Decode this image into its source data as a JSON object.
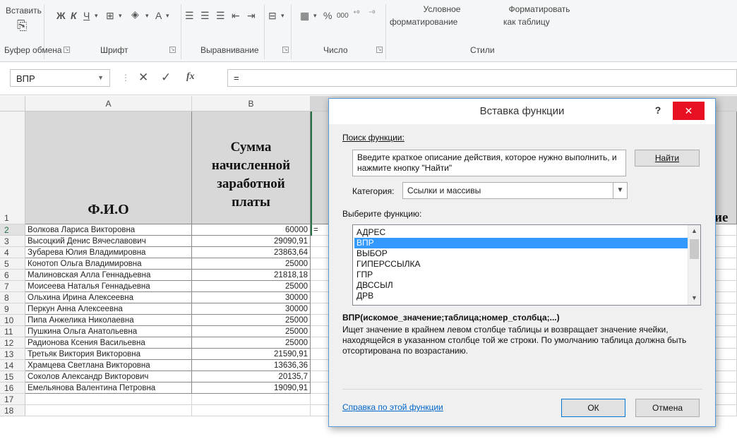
{
  "ribbon": {
    "paste_label": "Вставить",
    "font_buttons": [
      "Ж",
      "К",
      "Ч"
    ],
    "percent_label": "%",
    "thousands_label": "000",
    "cond_format_line1": "Условное",
    "cond_format_line2": "форматирование",
    "format_table_line1": "Форматировать",
    "format_table_line2": "как таблицу",
    "groups": {
      "clipboard": "Буфер обмена",
      "font": "Шрифт",
      "alignment": "Выравнивание",
      "number": "Число",
      "styles": "Стили"
    }
  },
  "formula_bar": {
    "name_box": "ВПР",
    "fx_label": "fx",
    "formula": "="
  },
  "sheet": {
    "columns": [
      "A",
      "B"
    ],
    "header_fio": "Ф.И.О",
    "header_sum_lines": [
      "Сумма",
      "начисленной",
      "заработной",
      "платы"
    ],
    "header_d_tail": "ие",
    "editing_cell": "=",
    "rows": [
      {
        "n": "2",
        "name": "Волкова Лариса Викторовна",
        "value": "60000"
      },
      {
        "n": "3",
        "name": "Высоцкий Денис Вячеславович",
        "value": "29090,91"
      },
      {
        "n": "4",
        "name": "Зубарева Юлия Владимировна",
        "value": "23863,64"
      },
      {
        "n": "5",
        "name": "Конотоп Ольга Владимировна",
        "value": "25000"
      },
      {
        "n": "6",
        "name": "Малиновская Алла Геннадьевна",
        "value": "21818,18"
      },
      {
        "n": "7",
        "name": "Моисеева Наталья Геннадьевна",
        "value": "25000"
      },
      {
        "n": "8",
        "name": "Ольхина Ирина Алексеевна",
        "value": "30000"
      },
      {
        "n": "9",
        "name": "Перкун Анна Алексеевна",
        "value": "30000"
      },
      {
        "n": "10",
        "name": "Пипа Анжелика Николаевна",
        "value": "25000"
      },
      {
        "n": "11",
        "name": "Пушкина Ольга Анатольевна",
        "value": "25000"
      },
      {
        "n": "12",
        "name": "Радионова Ксения Васильевна",
        "value": "25000"
      },
      {
        "n": "13",
        "name": "Третьяк Виктория Викторовна",
        "value": "21590,91"
      },
      {
        "n": "14",
        "name": "Храмцева Светлана Викторовна",
        "value": "13636,36"
      },
      {
        "n": "15",
        "name": "Соколов Александр Викторович",
        "value": "20135,7"
      },
      {
        "n": "16",
        "name": "Емельянова Валентина Петровна",
        "value": "19090,91"
      },
      {
        "n": "17",
        "name": "",
        "value": ""
      },
      {
        "n": "18",
        "name": "",
        "value": ""
      }
    ],
    "row1_label": "1"
  },
  "dialog": {
    "title": "Вставка функции",
    "help": "?",
    "close": "✕",
    "search_label": "Поиск функции:",
    "search_text": "Введите краткое описание действия, которое нужно выполнить, и нажмите кнопку \"Найти\"",
    "find_button": "Найти",
    "category_label": "Категория:",
    "category_value": "Ссылки и массивы",
    "choose_label": "Выберите функцию:",
    "functions": [
      "АДРЕС",
      "ВПР",
      "ВЫБОР",
      "ГИПЕРССЫЛКА",
      "ГПР",
      "ДВССЫЛ",
      "ДРВ"
    ],
    "selected_function": "ВПР",
    "signature": "ВПР(искомое_значение;таблица;номер_столбца;...)",
    "description": "Ищет значение в крайнем левом столбце таблицы и возвращает значение ячейки, находящейся в указанном столбце той же строки. По умолчанию таблица должна быть отсортирована по возрастанию.",
    "help_link": "Справка по этой функции",
    "ok_button": "ОК",
    "cancel_button": "Отмена"
  },
  "colors": {
    "selection_blue": "#3399ff",
    "close_red": "#e81123",
    "link_blue": "#0066cc",
    "active_cell_green": "#217346"
  }
}
